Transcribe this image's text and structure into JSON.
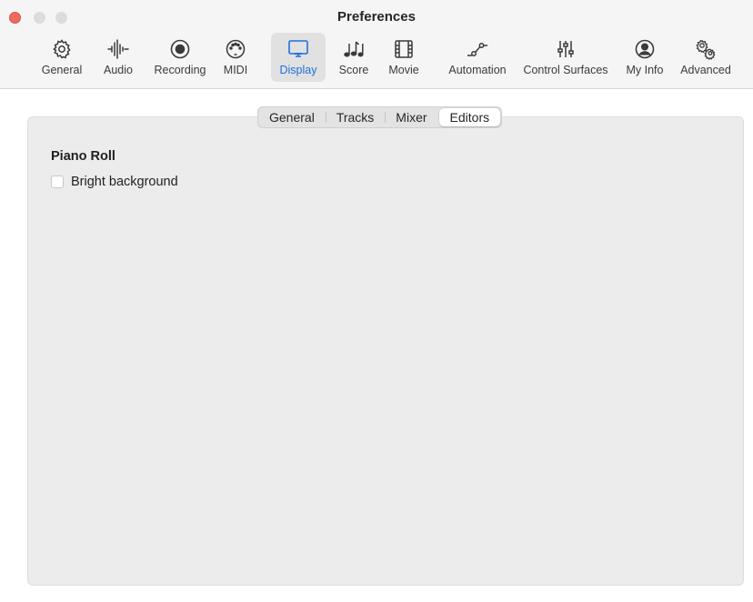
{
  "window": {
    "title": "Preferences"
  },
  "toolbar": {
    "tabs": [
      {
        "label": "General",
        "icon": "gear-icon"
      },
      {
        "label": "Audio",
        "icon": "waveform-icon"
      },
      {
        "label": "Recording",
        "icon": "record-icon"
      },
      {
        "label": "MIDI",
        "icon": "midi-connector-icon"
      },
      {
        "label": "Display",
        "icon": "monitor-icon",
        "selected": true
      },
      {
        "label": "Score",
        "icon": "music-notes-icon"
      },
      {
        "label": "Movie",
        "icon": "film-icon"
      },
      {
        "label": "Automation",
        "icon": "automation-curve-icon"
      },
      {
        "label": "Control Surfaces",
        "icon": "sliders-icon"
      },
      {
        "label": "My Info",
        "icon": "person-icon"
      },
      {
        "label": "Advanced",
        "icon": "gears-icon"
      }
    ]
  },
  "subtabs": {
    "items": [
      "General",
      "Tracks",
      "Mixer",
      "Editors"
    ],
    "selected": "Editors"
  },
  "editors": {
    "section_title": "Piano Roll",
    "bright_background": {
      "label": "Bright background",
      "checked": false
    }
  },
  "colors": {
    "accent": "#1f6fe0",
    "close_button": "#ed6a5e",
    "panel_bg": "#ececec"
  }
}
